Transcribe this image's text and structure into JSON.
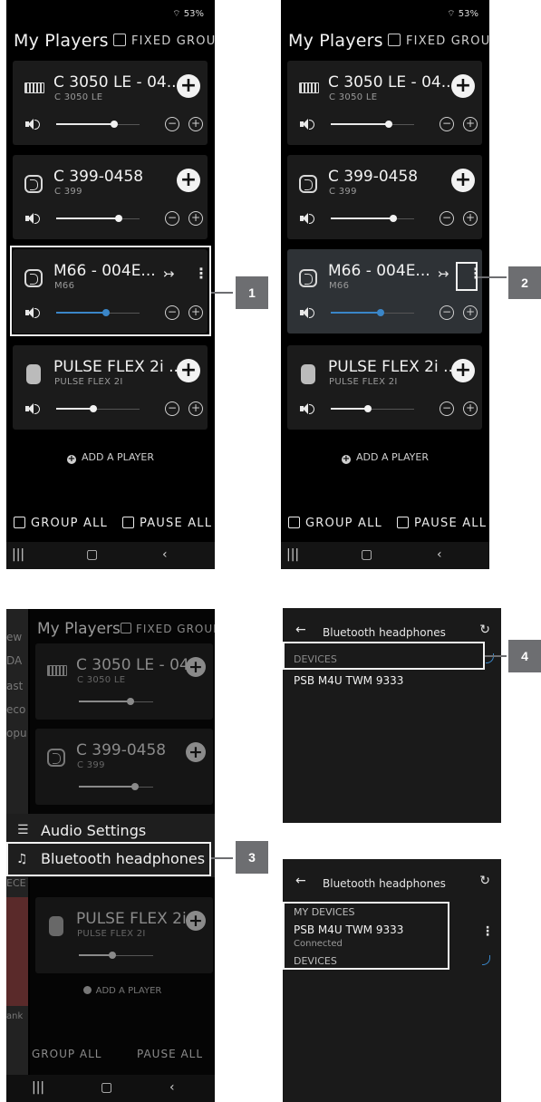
{
  "status": {
    "battery": "53%"
  },
  "app": {
    "title": "My Players",
    "fixed_group": "FIXED GROUP"
  },
  "players": [
    {
      "name": "C 3050 LE - 04...",
      "model": "C 3050 LE",
      "icon": "amplifier-icon",
      "volume": 0.7
    },
    {
      "name": "C 399-0458",
      "model": "C 399",
      "icon": "bluos-device-icon",
      "volume": 0.75
    },
    {
      "name": "M66 - 004E...",
      "model": "M66",
      "icon": "bluos-device-icon",
      "volume": 0.6
    },
    {
      "name": "PULSE FLEX 2i ...",
      "model": "PULSE FLEX 2I",
      "icon": "speaker-icon",
      "volume": 0.45
    }
  ],
  "actions": {
    "add_player": "ADD A PLAYER",
    "group_all": "GROUP ALL",
    "pause_all": "PAUSE ALL"
  },
  "menu": {
    "audio_settings": "Audio Settings",
    "bluetooth_headphones": "Bluetooth headphones"
  },
  "bluetooth": {
    "title": "Bluetooth headphones",
    "devices_label": "DEVICES",
    "my_devices_label": "MY DEVICES",
    "device_name": "PSB M4U TWM  9333",
    "device_status": "Connected"
  },
  "callouts": [
    "1",
    "2",
    "3",
    "4"
  ],
  "sidebar_fragments": [
    "ew",
    "DA",
    "ast",
    "eco",
    "opu",
    "ECE",
    "ank"
  ],
  "colors": {
    "accent": "#3a86c8",
    "callout": "#6d6e71"
  }
}
